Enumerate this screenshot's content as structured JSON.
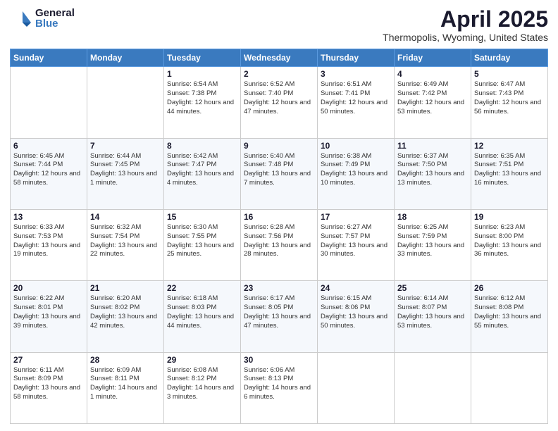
{
  "header": {
    "logo_general": "General",
    "logo_blue": "Blue",
    "title": "April 2025",
    "subtitle": "Thermopolis, Wyoming, United States"
  },
  "calendar": {
    "days_of_week": [
      "Sunday",
      "Monday",
      "Tuesday",
      "Wednesday",
      "Thursday",
      "Friday",
      "Saturday"
    ],
    "weeks": [
      [
        {
          "day": "",
          "info": ""
        },
        {
          "day": "",
          "info": ""
        },
        {
          "day": "1",
          "info": "Sunrise: 6:54 AM\nSunset: 7:38 PM\nDaylight: 12 hours and 44 minutes."
        },
        {
          "day": "2",
          "info": "Sunrise: 6:52 AM\nSunset: 7:40 PM\nDaylight: 12 hours and 47 minutes."
        },
        {
          "day": "3",
          "info": "Sunrise: 6:51 AM\nSunset: 7:41 PM\nDaylight: 12 hours and 50 minutes."
        },
        {
          "day": "4",
          "info": "Sunrise: 6:49 AM\nSunset: 7:42 PM\nDaylight: 12 hours and 53 minutes."
        },
        {
          "day": "5",
          "info": "Sunrise: 6:47 AM\nSunset: 7:43 PM\nDaylight: 12 hours and 56 minutes."
        }
      ],
      [
        {
          "day": "6",
          "info": "Sunrise: 6:45 AM\nSunset: 7:44 PM\nDaylight: 12 hours and 58 minutes."
        },
        {
          "day": "7",
          "info": "Sunrise: 6:44 AM\nSunset: 7:45 PM\nDaylight: 13 hours and 1 minute."
        },
        {
          "day": "8",
          "info": "Sunrise: 6:42 AM\nSunset: 7:47 PM\nDaylight: 13 hours and 4 minutes."
        },
        {
          "day": "9",
          "info": "Sunrise: 6:40 AM\nSunset: 7:48 PM\nDaylight: 13 hours and 7 minutes."
        },
        {
          "day": "10",
          "info": "Sunrise: 6:38 AM\nSunset: 7:49 PM\nDaylight: 13 hours and 10 minutes."
        },
        {
          "day": "11",
          "info": "Sunrise: 6:37 AM\nSunset: 7:50 PM\nDaylight: 13 hours and 13 minutes."
        },
        {
          "day": "12",
          "info": "Sunrise: 6:35 AM\nSunset: 7:51 PM\nDaylight: 13 hours and 16 minutes."
        }
      ],
      [
        {
          "day": "13",
          "info": "Sunrise: 6:33 AM\nSunset: 7:53 PM\nDaylight: 13 hours and 19 minutes."
        },
        {
          "day": "14",
          "info": "Sunrise: 6:32 AM\nSunset: 7:54 PM\nDaylight: 13 hours and 22 minutes."
        },
        {
          "day": "15",
          "info": "Sunrise: 6:30 AM\nSunset: 7:55 PM\nDaylight: 13 hours and 25 minutes."
        },
        {
          "day": "16",
          "info": "Sunrise: 6:28 AM\nSunset: 7:56 PM\nDaylight: 13 hours and 28 minutes."
        },
        {
          "day": "17",
          "info": "Sunrise: 6:27 AM\nSunset: 7:57 PM\nDaylight: 13 hours and 30 minutes."
        },
        {
          "day": "18",
          "info": "Sunrise: 6:25 AM\nSunset: 7:59 PM\nDaylight: 13 hours and 33 minutes."
        },
        {
          "day": "19",
          "info": "Sunrise: 6:23 AM\nSunset: 8:00 PM\nDaylight: 13 hours and 36 minutes."
        }
      ],
      [
        {
          "day": "20",
          "info": "Sunrise: 6:22 AM\nSunset: 8:01 PM\nDaylight: 13 hours and 39 minutes."
        },
        {
          "day": "21",
          "info": "Sunrise: 6:20 AM\nSunset: 8:02 PM\nDaylight: 13 hours and 42 minutes."
        },
        {
          "day": "22",
          "info": "Sunrise: 6:18 AM\nSunset: 8:03 PM\nDaylight: 13 hours and 44 minutes."
        },
        {
          "day": "23",
          "info": "Sunrise: 6:17 AM\nSunset: 8:05 PM\nDaylight: 13 hours and 47 minutes."
        },
        {
          "day": "24",
          "info": "Sunrise: 6:15 AM\nSunset: 8:06 PM\nDaylight: 13 hours and 50 minutes."
        },
        {
          "day": "25",
          "info": "Sunrise: 6:14 AM\nSunset: 8:07 PM\nDaylight: 13 hours and 53 minutes."
        },
        {
          "day": "26",
          "info": "Sunrise: 6:12 AM\nSunset: 8:08 PM\nDaylight: 13 hours and 55 minutes."
        }
      ],
      [
        {
          "day": "27",
          "info": "Sunrise: 6:11 AM\nSunset: 8:09 PM\nDaylight: 13 hours and 58 minutes."
        },
        {
          "day": "28",
          "info": "Sunrise: 6:09 AM\nSunset: 8:11 PM\nDaylight: 14 hours and 1 minute."
        },
        {
          "day": "29",
          "info": "Sunrise: 6:08 AM\nSunset: 8:12 PM\nDaylight: 14 hours and 3 minutes."
        },
        {
          "day": "30",
          "info": "Sunrise: 6:06 AM\nSunset: 8:13 PM\nDaylight: 14 hours and 6 minutes."
        },
        {
          "day": "",
          "info": ""
        },
        {
          "day": "",
          "info": ""
        },
        {
          "day": "",
          "info": ""
        }
      ]
    ]
  }
}
